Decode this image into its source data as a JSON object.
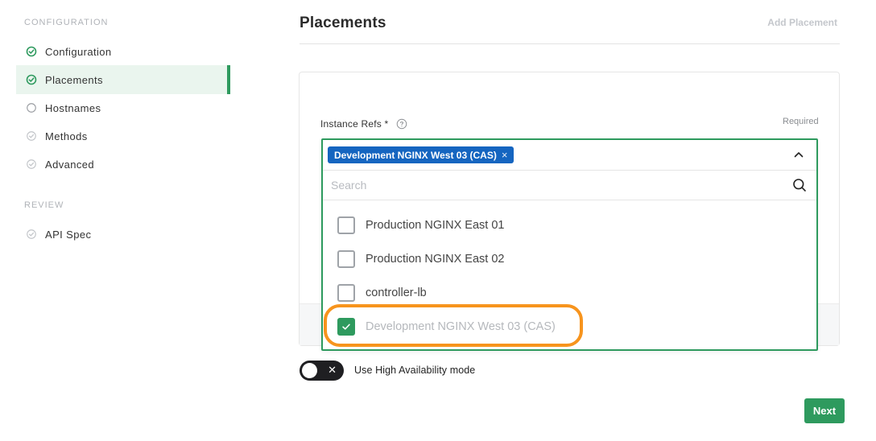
{
  "sidebar": {
    "configuration_title": "CONFIGURATION",
    "review_title": "REVIEW",
    "items": [
      {
        "label": "Configuration",
        "state": "complete"
      },
      {
        "label": "Placements",
        "state": "complete-active"
      },
      {
        "label": "Hostnames",
        "state": "pending"
      },
      {
        "label": "Methods",
        "state": "disabled"
      },
      {
        "label": "Advanced",
        "state": "disabled"
      }
    ],
    "review_items": [
      {
        "label": "API Spec",
        "state": "disabled"
      }
    ]
  },
  "header": {
    "title": "Placements",
    "add_placement_label": "Add Placement"
  },
  "form": {
    "instance_refs_label": "Instance Refs *",
    "required_label": "Required",
    "selected_chip": "Development NGINX West 03 (CAS)",
    "chip_remove": "×",
    "search_placeholder": "Search",
    "options": [
      {
        "label": "Production NGINX East 01",
        "checked": false
      },
      {
        "label": "Production NGINX East 02",
        "checked": false
      },
      {
        "label": "controller-lb",
        "checked": false
      },
      {
        "label": "Development NGINX West 03 (CAS)",
        "checked": true
      }
    ]
  },
  "toggle": {
    "label": "Use High Availability mode",
    "x_glyph": "✕",
    "on": false
  },
  "footer": {
    "next_label": "Next"
  },
  "colors": {
    "accent_green": "#2e9a5e",
    "chip_blue": "#1565c0",
    "highlight_orange": "#f7941d"
  }
}
